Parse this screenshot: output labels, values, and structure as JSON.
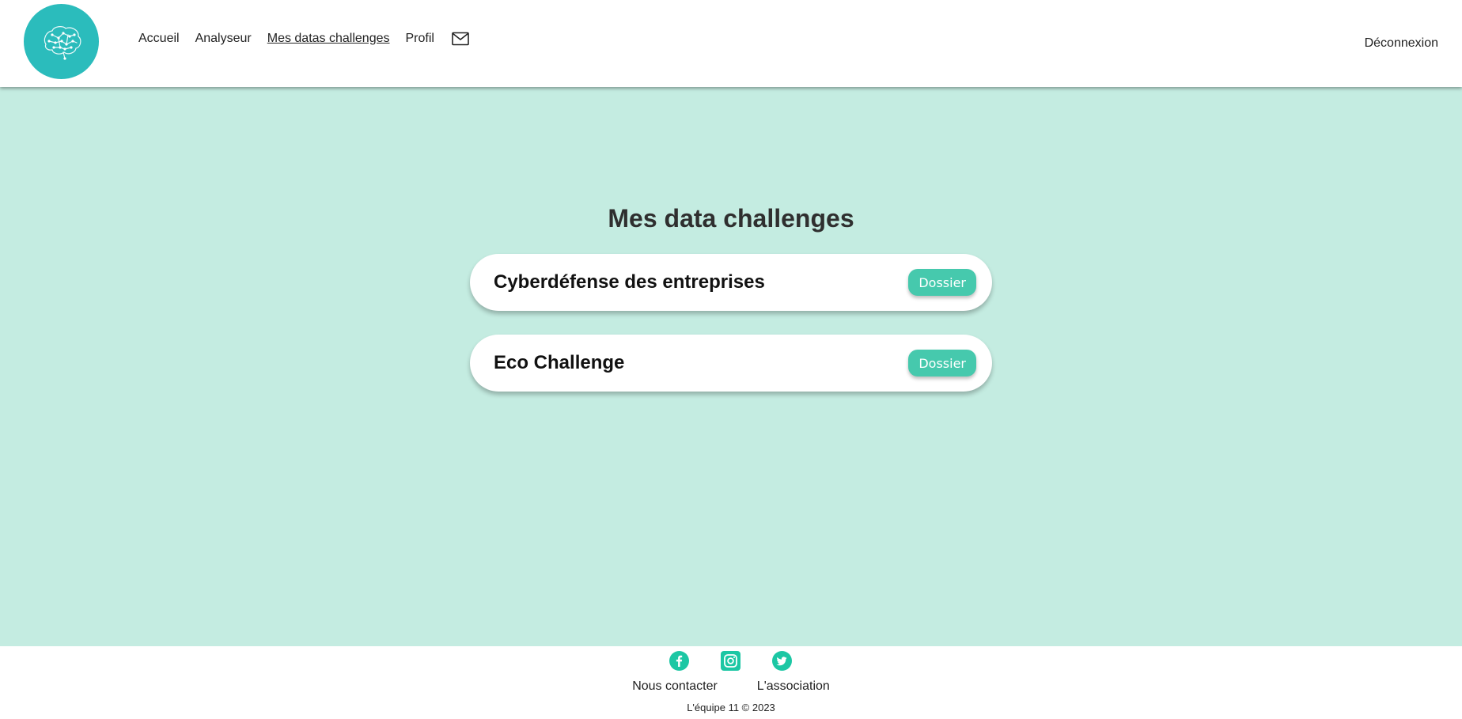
{
  "header": {
    "logo_icon": "brain-circuit-icon",
    "nav": {
      "home": "Accueil",
      "analyzer": "Analyseur",
      "my_challenges": "Mes datas challenges",
      "profile": "Profil",
      "mail_icon": "mail-icon"
    },
    "logout": "Déconnexion"
  },
  "main": {
    "title": "Mes data challenges",
    "challenges": [
      {
        "name": "Cyberdéfense des entreprises",
        "button": "Dossier"
      },
      {
        "name": "Eco Challenge",
        "button": "Dossier"
      }
    ]
  },
  "footer": {
    "socials": [
      "facebook-icon",
      "instagram-icon",
      "twitter-icon"
    ],
    "contact": "Nous contacter",
    "association": "L'association",
    "copyright": "L'équipe 11 © 2023"
  },
  "colors": {
    "background": "#c4ece1",
    "accent": "#46c9ad",
    "logo": "#2bbcbc",
    "social": "#1cc7a4"
  }
}
